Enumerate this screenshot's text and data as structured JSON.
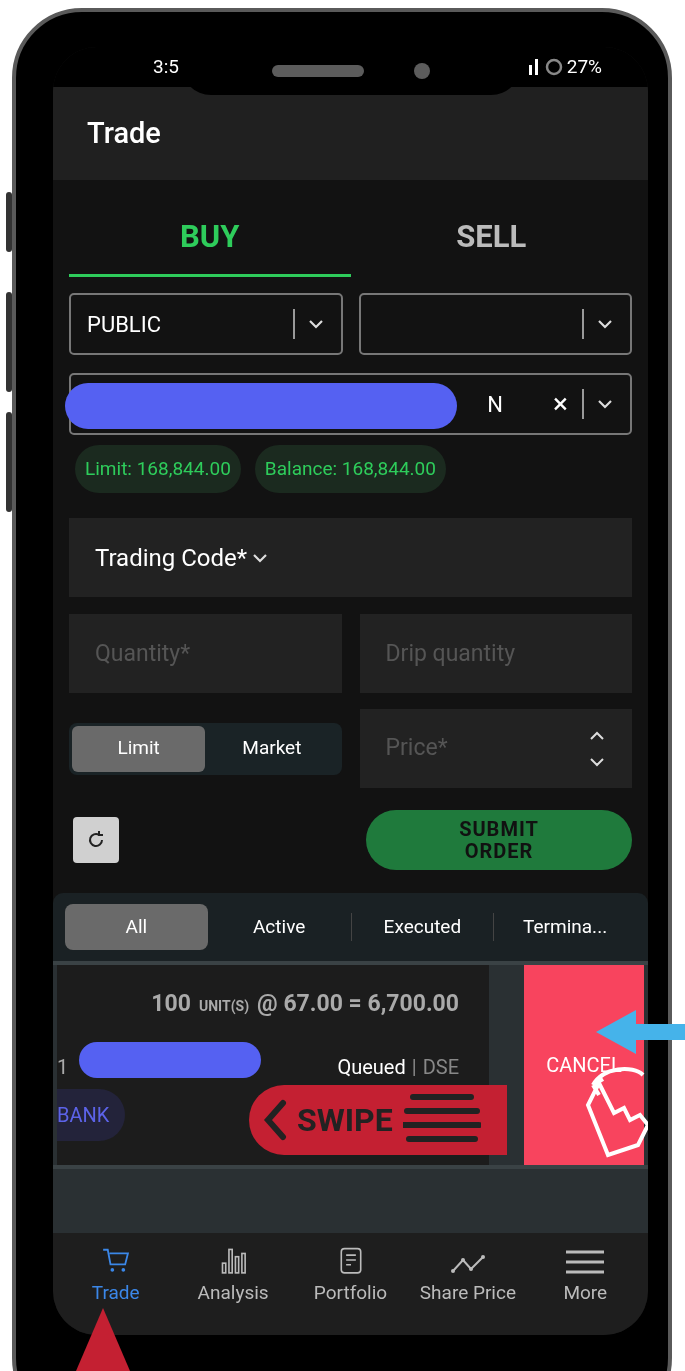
{
  "status_bar": {
    "time": "3:5",
    "battery": "27%"
  },
  "header": {
    "title": "Trade"
  },
  "side_tabs": [
    {
      "label": "BUY",
      "selected": true
    },
    {
      "label": "SELL",
      "selected": false
    }
  ],
  "selects": [
    {
      "kind": "filled",
      "value": "PUBLIC"
    },
    {
      "kind": "empty"
    }
  ],
  "account": {
    "value": "N",
    "clear": "×"
  },
  "badges": [
    "Limit: 168,844.00",
    "Balance: 168,844.00"
  ],
  "trading_code": {
    "label": "Trading Code*"
  },
  "fields": [
    {
      "placeholder": "Quantity*"
    },
    {
      "placeholder": "Drip quantity"
    }
  ],
  "order_type": [
    {
      "label": "Limit",
      "selected": true
    },
    {
      "label": "Market",
      "selected": false
    }
  ],
  "price": {
    "placeholder": "Price*"
  },
  "submit": "SUBMIT ORDER",
  "filters": [
    {
      "label": "All",
      "selected": true
    },
    {
      "label": "Active",
      "selected": false
    },
    {
      "label": "Executed",
      "selected": false
    },
    {
      "label": "Termina...",
      "selected": false
    }
  ],
  "order": {
    "qty": "100",
    "unit": "UNIT(S)",
    "calc": "@ 67.00 = 6,700.00",
    "id": "1",
    "status": "Queued",
    "separator": "|",
    "exchange": "DSE",
    "tag": "BANK",
    "action": "CANCEL"
  },
  "annotation": {
    "swipe": "SWIPE"
  },
  "nav": [
    {
      "label": "Trade",
      "selected": true
    },
    {
      "label": "Analysis",
      "selected": false
    },
    {
      "label": "Portfolio",
      "selected": false
    },
    {
      "label": "Share Price",
      "selected": false
    },
    {
      "label": "More",
      "selected": false
    }
  ]
}
